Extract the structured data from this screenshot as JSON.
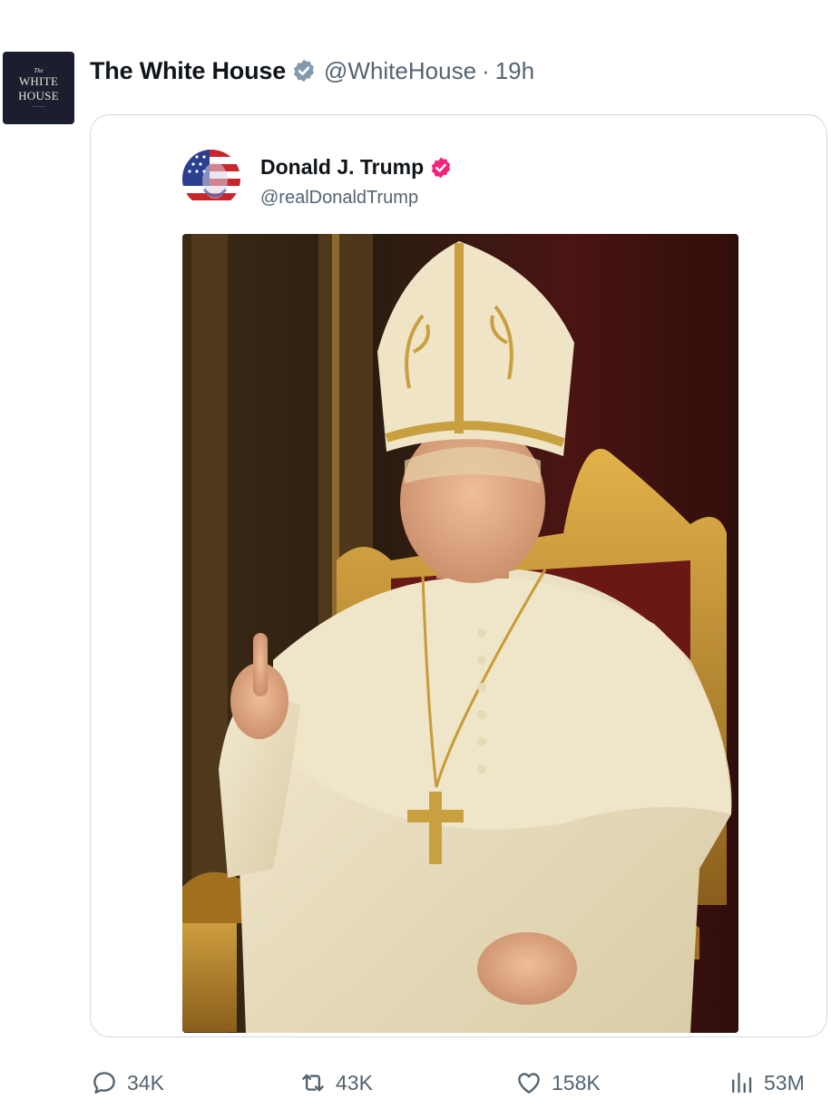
{
  "post": {
    "author": {
      "display_name": "The White House",
      "handle": "@WhiteHouse",
      "time": "19h",
      "separator": "·",
      "avatar_text": {
        "small": "The",
        "line1": "WHITE",
        "line2": "HOUSE"
      }
    },
    "quoted": {
      "display_name": "Donald J. Trump",
      "handle": "@realDonaldTrump"
    },
    "actions": {
      "replies": "34K",
      "reposts": "43K",
      "likes": "158K",
      "views": "53M"
    }
  },
  "colors": {
    "verified_gray": "#829aab",
    "verified_pink": "#f4247c",
    "muted_text": "#536471",
    "border": "#cfd9de"
  },
  "icons": [
    "verified-badge-icon",
    "reply-icon",
    "repost-icon",
    "like-icon",
    "views-icon"
  ]
}
